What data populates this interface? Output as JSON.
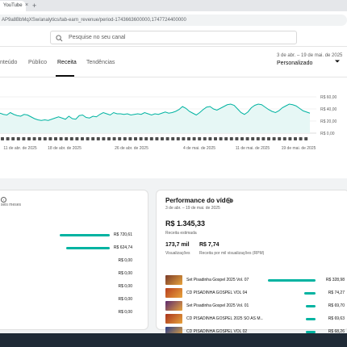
{
  "browser": {
    "tab_title": "YouTube",
    "tab_close": "×",
    "new_tab": "+",
    "url": "AP9a8BbMqXSw/analytics/tab-earn_revenue/period-1743663600000,1747724400000"
  },
  "search": {
    "placeholder": "Pesquise no seu canal"
  },
  "tabs": [
    {
      "label": "nteúdo",
      "active": false
    },
    {
      "label": "Público",
      "active": false
    },
    {
      "label": "Receita",
      "active": true
    },
    {
      "label": "Tendências",
      "active": false
    }
  ],
  "period": {
    "range": "3 de abr. – 19 de mai. de 2025",
    "label": "Personalizado"
  },
  "chart_data": {
    "type": "line",
    "y_ticks": [
      "R$ 60,00",
      "R$ 40,00",
      "R$ 20,00",
      "R$ 0,00"
    ],
    "ylim": [
      0,
      60
    ],
    "x_ticks": [
      "11 de abr. de 2025",
      "18 de abr. de 2025",
      "26 de abr. de 2025",
      "4 de mai. de 2025",
      "11 de mai. de 2025",
      "19 de mai. de 2025"
    ],
    "values": [
      33,
      31,
      30,
      34,
      31,
      29,
      28,
      31,
      30,
      27,
      24,
      22,
      21,
      22,
      21,
      23,
      25,
      27,
      25,
      23,
      28,
      24,
      23,
      29,
      30,
      26,
      25,
      28,
      27,
      31,
      34,
      32,
      30,
      34,
      32,
      32,
      31,
      32,
      30,
      31,
      32,
      31,
      34,
      32,
      30,
      32,
      31,
      33,
      35,
      33,
      34,
      36,
      39,
      44,
      41,
      36,
      33,
      30,
      34,
      39,
      43,
      44,
      40,
      38,
      41,
      44,
      47,
      48,
      46,
      40,
      34,
      31,
      35,
      42,
      46,
      48,
      47,
      43,
      39,
      36,
      34,
      37,
      42,
      45,
      48,
      47,
      45,
      41,
      37,
      35,
      33
    ],
    "color": "#00b3a1",
    "grid": true
  },
  "left_card": {
    "subtitle": "seis meses",
    "rows": [
      {
        "value": "R$ 720,61",
        "fraction": 0.98
      },
      {
        "value": "R$ 624,74",
        "fraction": 0.85
      },
      {
        "value": "R$ 0,00",
        "fraction": 0
      },
      {
        "value": "R$ 0,00",
        "fraction": 0
      },
      {
        "value": "R$ 0,00",
        "fraction": 0
      },
      {
        "value": "R$ 0,00",
        "fraction": 0
      },
      {
        "value": "R$ 0,00",
        "fraction": 0
      }
    ]
  },
  "performance": {
    "title": "Performance do vídeo",
    "range": "3 de abr. – 19 de mai. de 2025",
    "revenue": "R$ 1.345,33",
    "revenue_label": "Receita estimada",
    "views": "173,7 mil",
    "views_label": "Visualizações",
    "rpm": "R$ 7,74",
    "rpm_label": "Receita por mil visualizações (RPM)",
    "videos": [
      {
        "name": "Set Pisadinha Gospel 2025 Vol. 07",
        "value": "R$ 328,98",
        "fraction": 1.0,
        "thumb_color": "#7a3b2a"
      },
      {
        "name": "CD PISADINHA GOSPEL VOL 04",
        "value": "R$ 74,27",
        "fraction": 0.23,
        "thumb_color": "#b8401f"
      },
      {
        "name": "Set Pisadinha Gospel 2025 Vol. 01",
        "value": "R$ 69,70",
        "fraction": 0.21,
        "thumb_color": "#5b2a6e"
      },
      {
        "name": "CD PISADINHA GOSPEL 2025 SO AS M...",
        "value": "R$ 69,63",
        "fraction": 0.21,
        "thumb_color": "#a8321c"
      },
      {
        "name": "CD PISADINHA GOSPEL VOL 02",
        "value": "R$ 68,26",
        "fraction": 0.21,
        "thumb_color": "#2a3f8a"
      }
    ]
  }
}
